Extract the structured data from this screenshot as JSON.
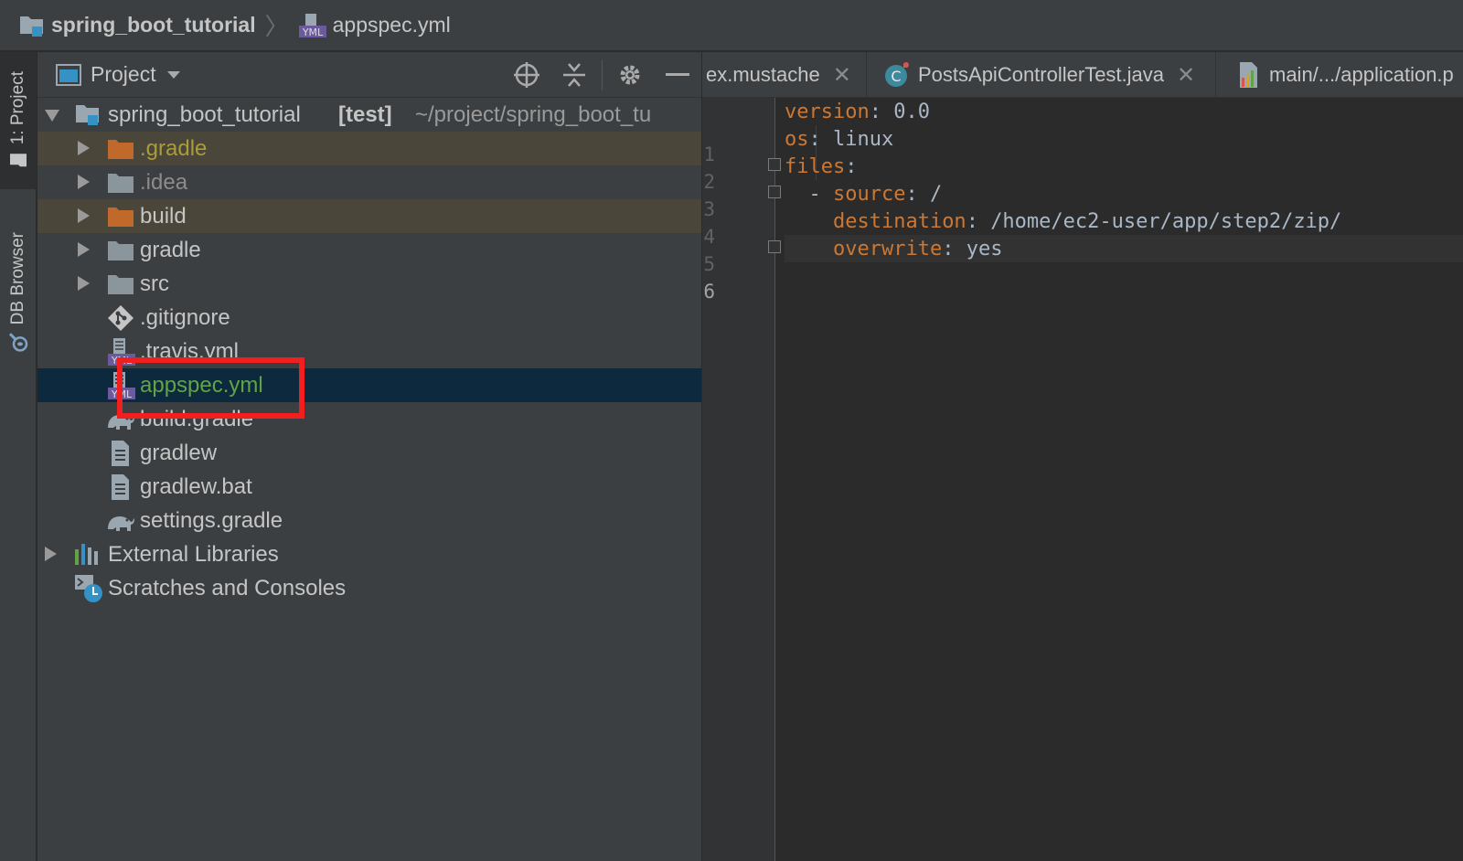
{
  "breadcrumb": {
    "root": "spring_boot_tutorial",
    "file": "appspec.yml"
  },
  "sidebar_tabs": {
    "project": "1: Project",
    "db_browser": "DB Browser"
  },
  "project_panel": {
    "title": "Project",
    "root": {
      "name": "spring_boot_tutorial",
      "module": "[test]",
      "path": "~/project/spring_boot_tu"
    },
    "items": [
      {
        "label": ".gradle"
      },
      {
        "label": ".idea"
      },
      {
        "label": "build"
      },
      {
        "label": "gradle"
      },
      {
        "label": "src"
      },
      {
        "label": ".gitignore"
      },
      {
        "label": ".travis.yml"
      },
      {
        "label": "appspec.yml"
      },
      {
        "label": "build.gradle"
      },
      {
        "label": "gradlew"
      },
      {
        "label": "gradlew.bat"
      },
      {
        "label": "settings.gradle"
      },
      {
        "label": "External Libraries"
      },
      {
        "label": "Scratches and Consoles"
      }
    ]
  },
  "editor": {
    "tabs": [
      {
        "label": "ex.mustache"
      },
      {
        "label": "PostsApiControllerTest.java"
      },
      {
        "label": "main/.../application.p"
      }
    ],
    "line_numbers": [
      "1",
      "2",
      "3",
      "4",
      "5",
      "6"
    ],
    "lines": [
      {
        "key": "version",
        "sep": ": ",
        "value": "0.0"
      },
      {
        "key": "os",
        "sep": ": ",
        "value": "linux"
      },
      {
        "key": "files",
        "sep": ":",
        "value": ""
      },
      {
        "dash": "- ",
        "key": "source",
        "sep": ": ",
        "value": "/"
      },
      {
        "key": "destination",
        "sep": ": ",
        "value": "/home/ec2-user/app/step2/zip/"
      },
      {
        "key": "overwrite",
        "sep": ": ",
        "value": "yes"
      }
    ]
  },
  "colors": {
    "yaml_key": "#cc7832",
    "selected_row": "#0d293e",
    "highlight_box": "#f31f1f",
    "excluded_folder": "#c0692b"
  }
}
